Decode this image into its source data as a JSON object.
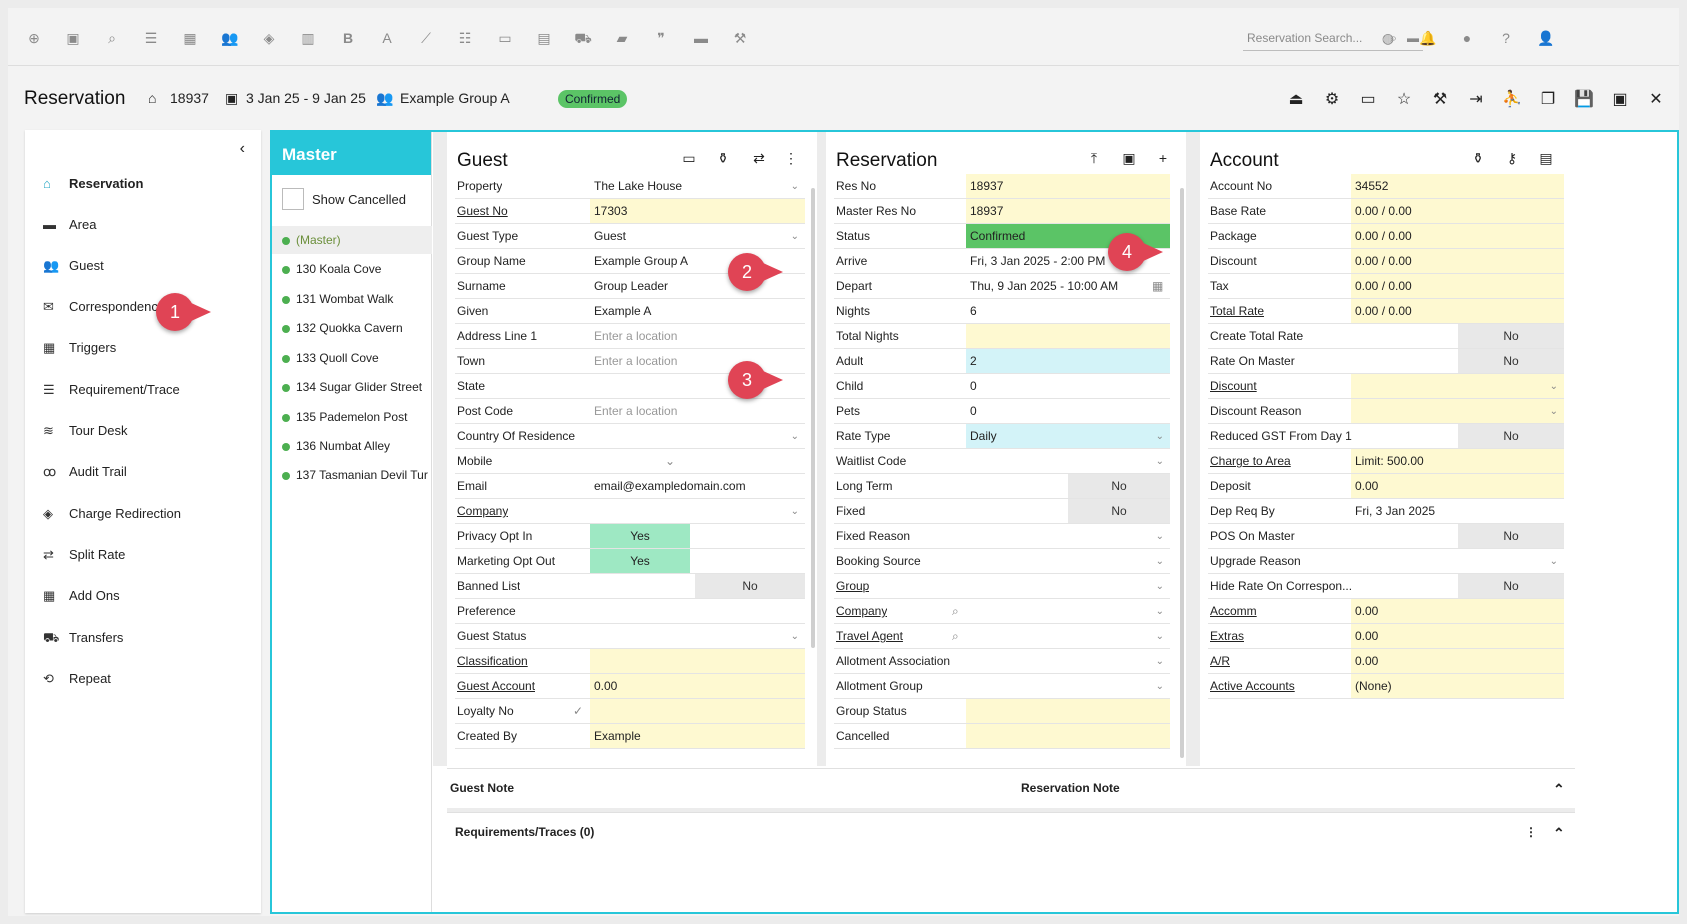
{
  "topbar": {
    "icons": [
      "add-circle-icon",
      "calendar-icon",
      "search-icon",
      "sliders-icon",
      "grid-icon",
      "people-icon",
      "map-pin-icon",
      "map-icon",
      "bold-icon",
      "font-icon",
      "chart-icon",
      "checklist-icon",
      "card-icon",
      "document-icon",
      "cart-icon",
      "ticket-icon",
      "quote-icon",
      "bed-icon",
      "hammer-icon"
    ],
    "search_placeholder": "Reservation Search...",
    "right_icons": [
      "globe-icon",
      "bell-icon",
      "chat-icon",
      "help-icon",
      "user-icon"
    ]
  },
  "header": {
    "title": "Reservation",
    "res_no": "18937",
    "dates": "3 Jan 25 - 9 Jan 25",
    "group": "Example Group A",
    "status": "Confirmed"
  },
  "nav": {
    "items": [
      {
        "label": "Reservation",
        "icon": "home-icon"
      },
      {
        "label": "Area",
        "icon": "bed-icon"
      },
      {
        "label": "Guest",
        "icon": "people-icon"
      },
      {
        "label": "Correspondence",
        "icon": "mail-icon"
      },
      {
        "label": "Triggers",
        "icon": "trigger-icon"
      },
      {
        "label": "Requirement/Trace",
        "icon": "list-icon"
      },
      {
        "label": "Tour Desk",
        "icon": "tour-icon"
      },
      {
        "label": "Audit Trail",
        "icon": "glasses-icon"
      },
      {
        "label": "Charge Redirection",
        "icon": "diamond-icon"
      },
      {
        "label": "Split Rate",
        "icon": "split-icon"
      },
      {
        "label": "Add Ons",
        "icon": "grid-icon"
      },
      {
        "label": "Transfers",
        "icon": "transfer-icon"
      },
      {
        "label": "Repeat",
        "icon": "repeat-icon"
      }
    ]
  },
  "master": {
    "title": "Master",
    "show_cancelled": "Show Cancelled",
    "items": [
      "(Master)",
      "130 Koala Cove",
      "131 Wombat Walk",
      "132 Quokka Cavern",
      "133 Quoll Cove",
      "134 Sugar Glider Street",
      "135 Pademelon Post",
      "136 Numbat Alley",
      "137 Tasmanian Devil Tur"
    ]
  },
  "guest": {
    "title": "Guest",
    "rows": [
      {
        "label": "Property",
        "value": "The Lake House"
      },
      {
        "label": "Guest No",
        "value": "17303"
      },
      {
        "label": "Guest Type",
        "value": "Guest"
      },
      {
        "label": "Group Name",
        "value": "Example Group A"
      },
      {
        "label": "Surname",
        "value": "Group Leader"
      },
      {
        "label": "Given",
        "value": "Example A"
      },
      {
        "label": "Address Line 1",
        "value": "Enter a location"
      },
      {
        "label": "Town",
        "value": "Enter a location"
      },
      {
        "label": "State",
        "value": ""
      },
      {
        "label": "Post Code",
        "value": "Enter a location"
      },
      {
        "label": "Country Of Residence",
        "value": ""
      },
      {
        "label": "Mobile",
        "value": ""
      },
      {
        "label": "Email",
        "value": "email@exampledomain.com"
      },
      {
        "label": "Company",
        "value": ""
      },
      {
        "label": "Privacy Opt In",
        "value": "Yes"
      },
      {
        "label": "Marketing Opt Out",
        "value": "Yes"
      },
      {
        "label": "Banned List",
        "value": "No"
      },
      {
        "label": "Preference",
        "value": ""
      },
      {
        "label": "Guest Status",
        "value": ""
      },
      {
        "label": "Classification",
        "value": ""
      },
      {
        "label": "Guest Account",
        "value": "0.00"
      },
      {
        "label": "Loyalty No",
        "value": ""
      },
      {
        "label": "Created By",
        "value": "Example"
      }
    ]
  },
  "reservation": {
    "title": "Reservation",
    "rows": [
      {
        "label": "Res No",
        "value": "18937"
      },
      {
        "label": "Master Res No",
        "value": "18937"
      },
      {
        "label": "Status",
        "value": "Confirmed"
      },
      {
        "label": "Arrive",
        "value": "Fri, 3 Jan 2025 - 2:00 PM"
      },
      {
        "label": "Depart",
        "value": "Thu, 9 Jan 2025 - 10:00 AM"
      },
      {
        "label": "Nights",
        "value": "6"
      },
      {
        "label": "Total Nights",
        "value": ""
      },
      {
        "label": "Adult",
        "value": "2"
      },
      {
        "label": "Child",
        "value": "0"
      },
      {
        "label": "Pets",
        "value": "0"
      },
      {
        "label": "Rate Type",
        "value": "Daily"
      },
      {
        "label": "Waitlist Code",
        "value": ""
      },
      {
        "label": "Long Term",
        "value": "No"
      },
      {
        "label": "Fixed",
        "value": "No"
      },
      {
        "label": "Fixed Reason",
        "value": ""
      },
      {
        "label": "Booking Source",
        "value": ""
      },
      {
        "label": "Group",
        "value": ""
      },
      {
        "label": "Company",
        "value": ""
      },
      {
        "label": "Travel Agent",
        "value": ""
      },
      {
        "label": "Allotment Association",
        "value": ""
      },
      {
        "label": "Allotment Group",
        "value": ""
      },
      {
        "label": "Group Status",
        "value": ""
      },
      {
        "label": "Cancelled",
        "value": ""
      }
    ]
  },
  "account": {
    "title": "Account",
    "rows": [
      {
        "label": "Account No",
        "value": "34552"
      },
      {
        "label": "Base Rate",
        "value": "0.00 / 0.00"
      },
      {
        "label": "Package",
        "value": "0.00 / 0.00"
      },
      {
        "label": "Discount",
        "value": "0.00 / 0.00"
      },
      {
        "label": "Tax",
        "value": "0.00 / 0.00"
      },
      {
        "label": "Total Rate",
        "value": "0.00 / 0.00"
      },
      {
        "label": "Create Total Rate",
        "value": "No"
      },
      {
        "label": "Rate On Master",
        "value": "No"
      },
      {
        "label": "Discount",
        "value": ""
      },
      {
        "label": "Discount Reason",
        "value": ""
      },
      {
        "label": "Reduced GST From Day 1",
        "value": "No"
      },
      {
        "label": "Charge to Area",
        "value": "Limit: 500.00"
      },
      {
        "label": "Deposit",
        "value": "0.00"
      },
      {
        "label": "Dep Req By",
        "value": "Fri, 3 Jan 2025"
      },
      {
        "label": "POS On Master",
        "value": "No"
      },
      {
        "label": "Upgrade Reason",
        "value": ""
      },
      {
        "label": "Hide Rate On Correspon...",
        "value": "No"
      },
      {
        "label": "Accomm",
        "value": "0.00"
      },
      {
        "label": "Extras",
        "value": "0.00"
      },
      {
        "label": "A/R",
        "value": "0.00"
      },
      {
        "label": "Active Accounts",
        "value": "(None)"
      }
    ]
  },
  "bottom": {
    "guest_note": "Guest Note",
    "reservation_note": "Reservation Note",
    "requirements": "Requirements/Traces (0)"
  },
  "callouts": [
    "1",
    "2",
    "3",
    "4"
  ]
}
